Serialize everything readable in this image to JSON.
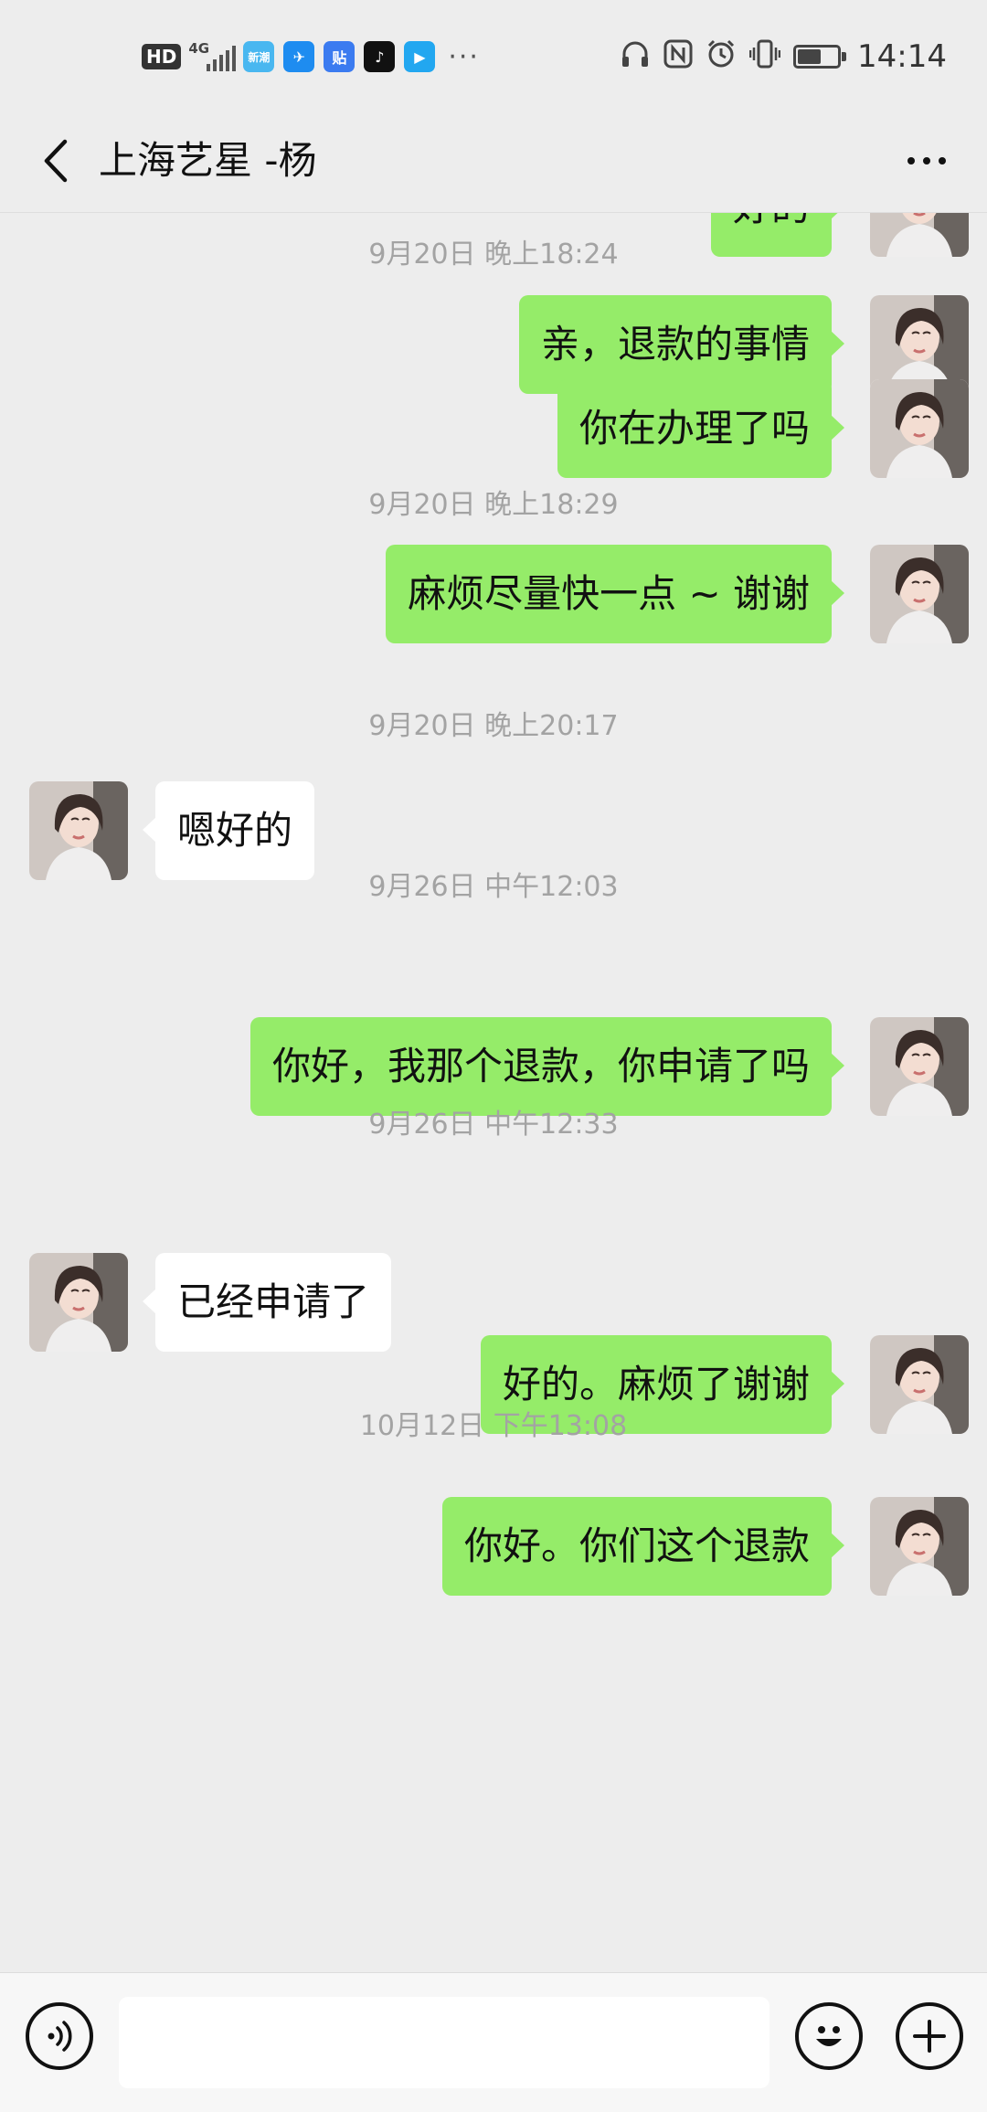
{
  "status_bar": {
    "hd_label": "HD",
    "network_label": "4G",
    "apps": [
      {
        "name": "xinchao-app-icon",
        "glyph": "新潮",
        "color": "#49b7f0"
      },
      {
        "name": "dingtalk-app-icon",
        "glyph": "✈",
        "color": "#1e8cf0"
      },
      {
        "name": "baidu-tieba-app-icon",
        "glyph": "贴",
        "color": "#3b7bf0"
      },
      {
        "name": "tiktok-app-icon",
        "glyph": "♪",
        "color": "#111111"
      },
      {
        "name": "youku-app-icon",
        "glyph": "▶",
        "color": "#22a7f0"
      }
    ],
    "overflow": "···",
    "time": "14:14",
    "battery_level": 0.6
  },
  "header": {
    "title": "上海艺星 -杨"
  },
  "messages": [
    {
      "type": "msg",
      "from": "me",
      "text": "好的"
    },
    {
      "type": "time",
      "text": "9月20日 晚上18:24"
    },
    {
      "type": "msg",
      "from": "me",
      "text": "亲，退款的事情"
    },
    {
      "type": "msg",
      "from": "me",
      "text": "你在办理了吗"
    },
    {
      "type": "time",
      "text": "9月20日 晚上18:29"
    },
    {
      "type": "msg",
      "from": "me",
      "text": "麻烦尽量快一点 ~ 谢谢"
    },
    {
      "type": "time",
      "text": "9月20日 晚上20:17"
    },
    {
      "type": "msg",
      "from": "them",
      "text": "嗯好的"
    },
    {
      "type": "time",
      "text": "9月26日 中午12:03"
    },
    {
      "type": "msg",
      "from": "me",
      "text": "你好，我那个退款，你申请了吗"
    },
    {
      "type": "time",
      "text": "9月26日 中午12:33"
    },
    {
      "type": "msg",
      "from": "them",
      "text": "已经申请了"
    },
    {
      "type": "msg",
      "from": "me",
      "text": "好的。麻烦了谢谢"
    },
    {
      "type": "time",
      "text": "10月12日 下午13:08"
    },
    {
      "type": "msg",
      "from": "me",
      "text": "你好。你们这个退款"
    }
  ],
  "input_bar": {
    "text": ""
  },
  "colors": {
    "background": "#ededed",
    "my_bubble": "#95ec69",
    "their_bubble": "#ffffff",
    "timestamp": "#a3a3a3"
  }
}
